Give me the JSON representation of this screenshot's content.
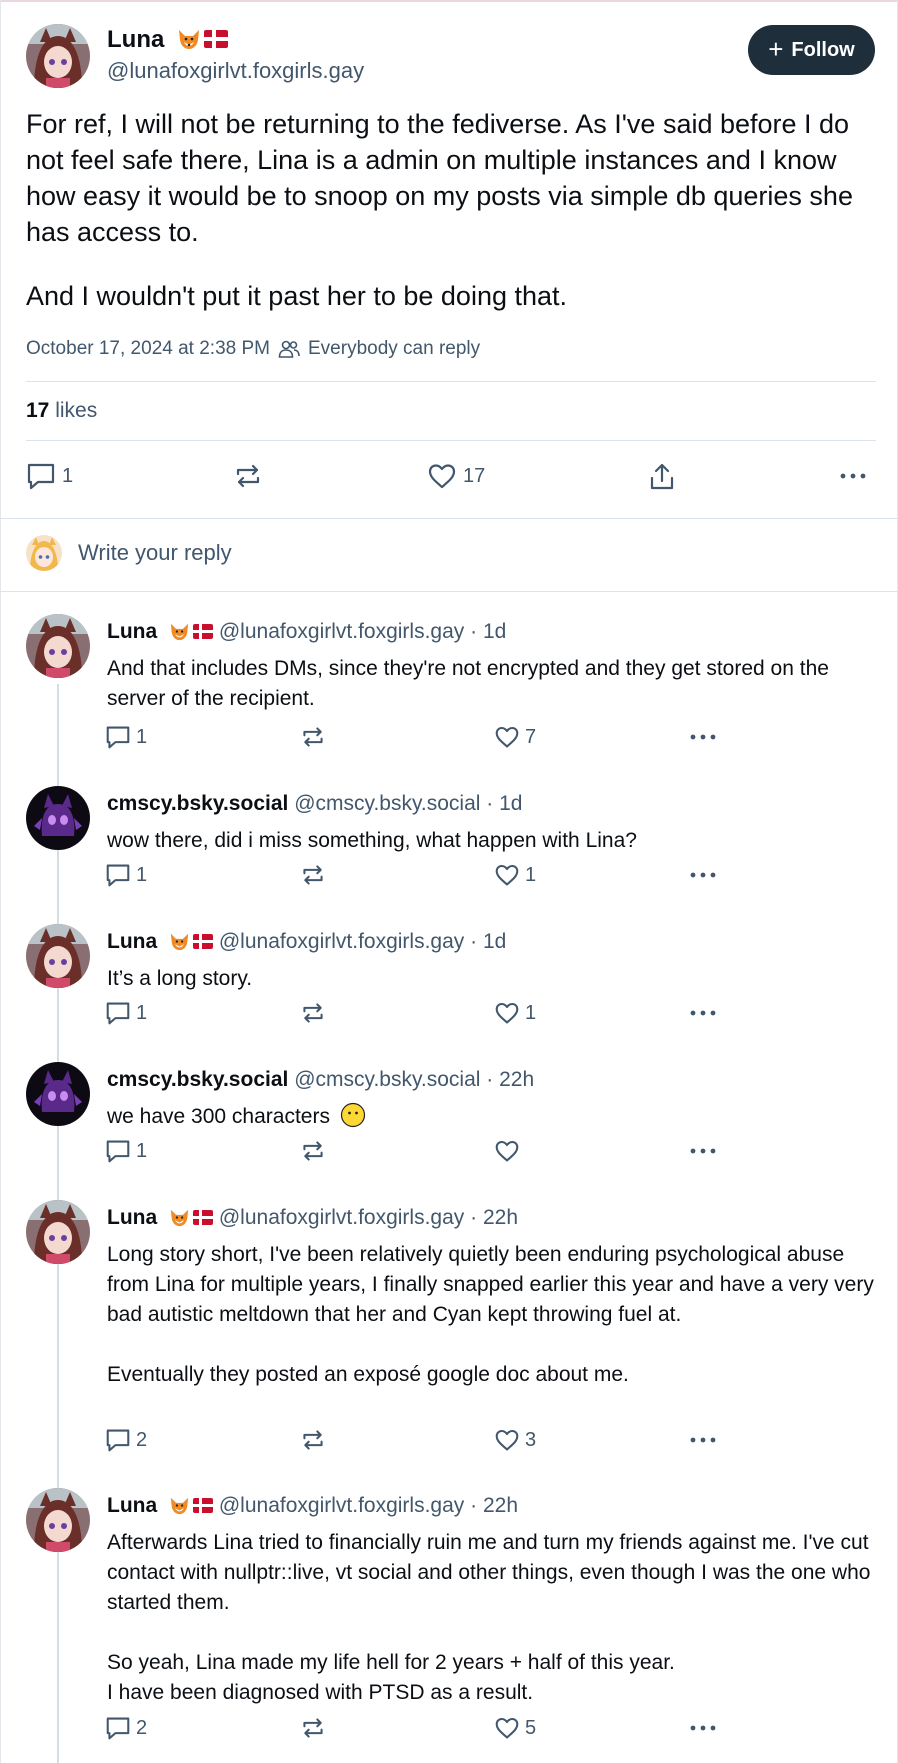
{
  "post": {
    "author_name": "Luna",
    "author_handle": "@lunafoxgirlvt.foxgirls.gay",
    "follow_label": "Follow",
    "text_p1": "For ref, I will not be returning to the fediverse. As I've said before I do not feel safe there, Lina is a admin on multiple instances and I know how easy it would be to snoop on my posts via simple db queries she has access to.",
    "text_p2": "And I wouldn't put it past her to be doing that.",
    "timestamp": "October 17, 2024 at 2:38 PM",
    "reply_setting": "Everybody can reply",
    "likes_count": "17",
    "likes_label": "likes",
    "reply_count": "1",
    "like_count": "17"
  },
  "reply_box": {
    "placeholder": "Write your reply"
  },
  "replies": [
    {
      "name": "Luna",
      "handle": "@lunafoxgirlvt.foxgirls.gay",
      "time": "1d",
      "paragraphs": [
        "And that includes DMs, since they're not encrypted and they get stored on the server of the recipient."
      ],
      "reply_count": "1",
      "like_count": "7"
    },
    {
      "name": "cmscy.bsky.social",
      "handle": "@cmscy.bsky.social",
      "time": "1d",
      "paragraphs": [
        "wow there, did i miss something, what happen with Lina?"
      ],
      "reply_count": "1",
      "like_count": "1"
    },
    {
      "name": "Luna",
      "handle": "@lunafoxgirlvt.foxgirls.gay",
      "time": "1d",
      "paragraphs": [
        "It’s a long story."
      ],
      "reply_count": "1",
      "like_count": "1"
    },
    {
      "name": "cmscy.bsky.social",
      "handle": "@cmscy.bsky.social",
      "time": "22h",
      "paragraphs": [
        "we have 300 characters"
      ],
      "reply_count": "1",
      "like_count": ""
    },
    {
      "name": "Luna",
      "handle": "@lunafoxgirlvt.foxgirls.gay",
      "time": "22h",
      "paragraphs": [
        "Long story short, I've been relatively quietly been enduring psychological abuse from Lina for multiple years, I finally snapped earlier this year and have a very very bad autistic meltdown that her and Cyan kept throwing fuel at.",
        "Eventually they posted an exposé google doc about me."
      ],
      "reply_count": "2",
      "like_count": "3"
    },
    {
      "name": "Luna",
      "handle": "@lunafoxgirlvt.foxgirls.gay",
      "time": "22h",
      "paragraphs": [
        "Afterwards Lina tried to financially ruin me and turn my friends against me. I've cut contact with nullptr::live, vt social and other things, even though I was the one who started them.",
        "So yeah, Lina made my life hell for 2 years + half of this year.\nI have been diagnosed with PTSD as a result."
      ],
      "reply_count": "2",
      "like_count": "5"
    }
  ],
  "colors": {
    "muted": "#42576c",
    "follow_bg": "#1f2e3b",
    "divider": "#dde3ea",
    "flag_red": "#c8102e"
  },
  "icons": [
    "fox-emoji-icon",
    "denmark-flag-icon",
    "plus-icon",
    "people-icon",
    "comment-icon",
    "repost-icon",
    "heart-icon",
    "share-icon",
    "more-icon",
    "neutral-face-emoji-icon"
  ]
}
